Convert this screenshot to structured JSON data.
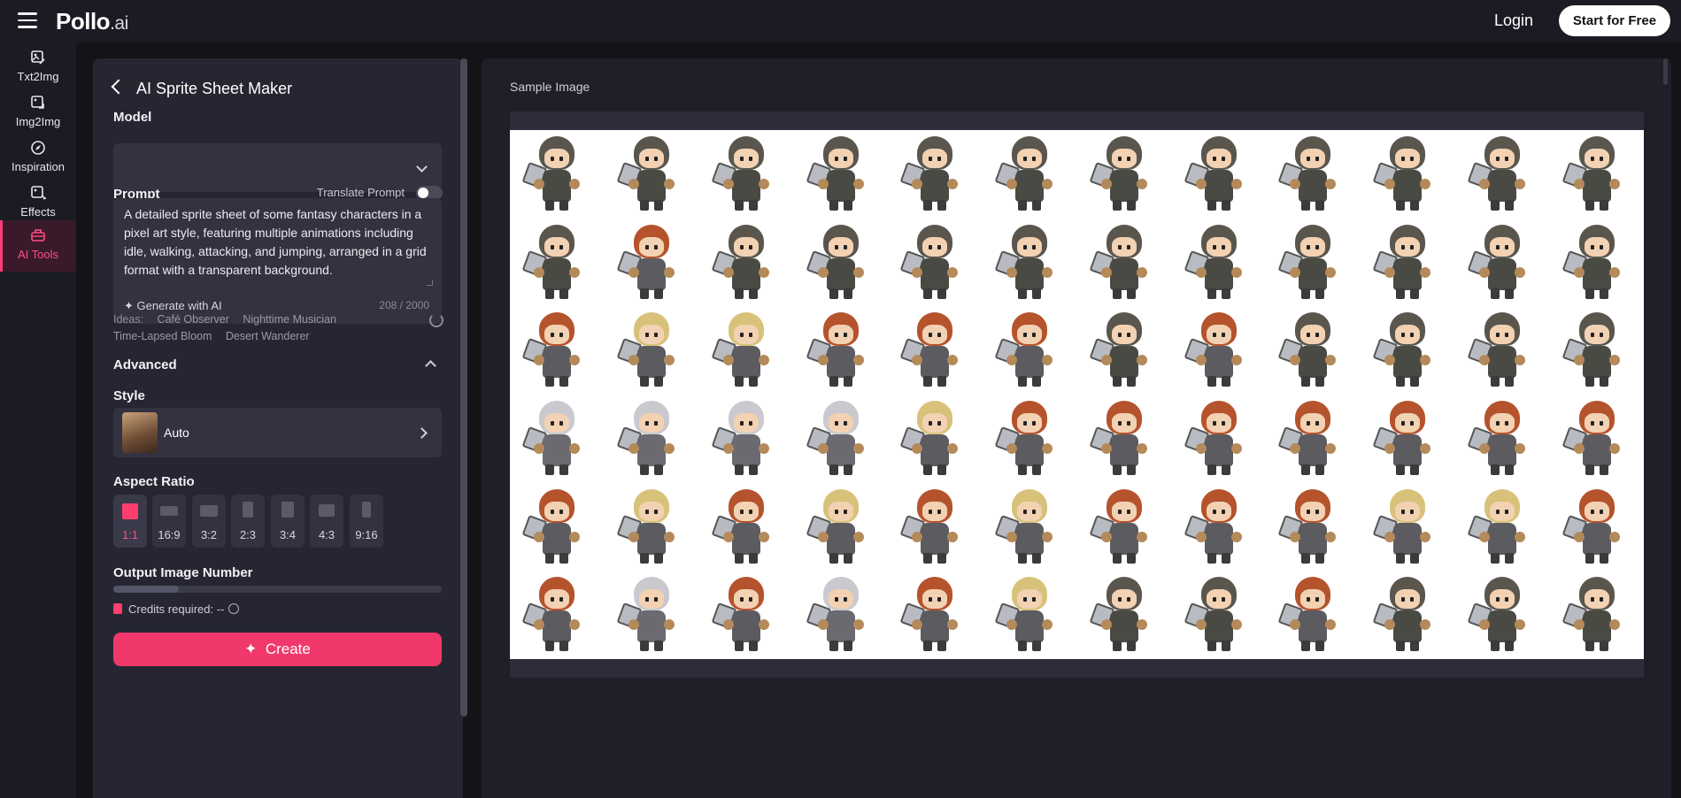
{
  "header": {
    "logo_main": "Pollo",
    "logo_suffix": ".ai",
    "login_label": "Login",
    "start_label": "Start for Free"
  },
  "rail": {
    "items": [
      {
        "label": "Txt2Img",
        "icon": "image-edit-icon"
      },
      {
        "label": "Img2Img",
        "icon": "image-swap-icon"
      },
      {
        "label": "Inspiration",
        "icon": "compass-icon"
      },
      {
        "label": "Effects",
        "icon": "sparkle-image-icon"
      },
      {
        "label": "AI Tools",
        "icon": "toolbox-icon",
        "active": true
      }
    ]
  },
  "panel": {
    "title": "AI Sprite Sheet Maker",
    "model_label": "Model",
    "model_value": "",
    "prompt_label": "Prompt",
    "translate_label": "Translate Prompt",
    "translate_on": false,
    "prompt_text": "A detailed sprite sheet of some fantasy characters in a pixel art style, featuring multiple animations including idle, walking, attacking, and jumping, arranged in a grid format with a transparent background.",
    "generate_label": "Generate with AI",
    "char_count": "208 / 2000",
    "ideas_label": "Ideas:",
    "ideas": [
      "Café Observer",
      "Nighttime Musician",
      "Time-Lapsed Bloom",
      "Desert Wanderer"
    ],
    "advanced_label": "Advanced",
    "style_label": "Style",
    "style_value": "Auto",
    "aspect_label": "Aspect Ratio",
    "aspect_ratios": [
      "1:1",
      "16:9",
      "3:2",
      "2:3",
      "3:4",
      "4:3",
      "9:16"
    ],
    "aspect_selected": "1:1",
    "output_label": "Output Image Number",
    "output_fraction": 0.2,
    "credits_label": "Credits required: --",
    "create_label": "Create"
  },
  "canvas": {
    "sample_label": "Sample Image"
  },
  "colors": {
    "accent": "#f0386b",
    "background": "#141418",
    "panel": "#262633"
  }
}
